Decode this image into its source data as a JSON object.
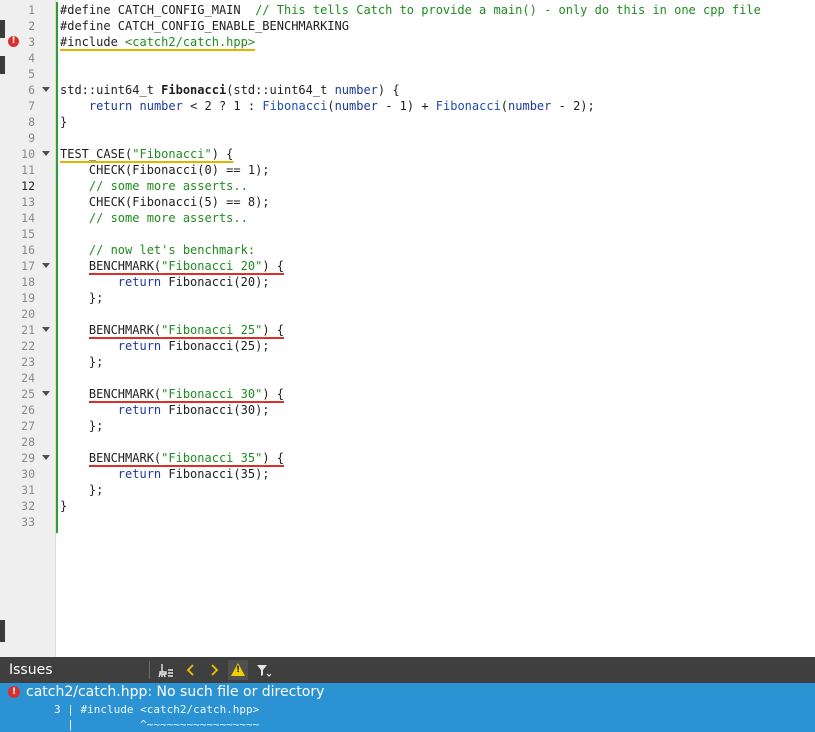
{
  "editor": {
    "current_line": 12,
    "lines": [
      {
        "n": "1",
        "segs": [
          {
            "t": "#define CATCH_CONFIG_MAIN  ",
            "c": "n"
          },
          {
            "t": "// This tells Catch to provide a main() - only do this in one cpp file",
            "c": "c"
          }
        ]
      },
      {
        "n": "2",
        "segs": [
          {
            "t": "#define CATCH_CONFIG_ENABLE_BENCHMARKING",
            "c": "n"
          }
        ]
      },
      {
        "n": "3",
        "error": true,
        "segs": [
          {
            "t": "#include ",
            "c": "n u"
          },
          {
            "t": "<catch2/catch.hpp>",
            "c": "s u"
          }
        ]
      },
      {
        "n": "4",
        "segs": []
      },
      {
        "n": "5",
        "segs": []
      },
      {
        "n": "6",
        "fold": true,
        "segs": [
          {
            "t": "std::uint64_t ",
            "c": "n"
          },
          {
            "t": "Fibonacci",
            "c": "f"
          },
          {
            "t": "(std::uint64_t ",
            "c": "n"
          },
          {
            "t": "number",
            "c": "k"
          },
          {
            "t": ") {",
            "c": "n"
          }
        ]
      },
      {
        "n": "7",
        "segs": [
          {
            "t": "    ",
            "c": "n"
          },
          {
            "t": "return",
            "c": "k"
          },
          {
            "t": " ",
            "c": "n"
          },
          {
            "t": "number",
            "c": "k"
          },
          {
            "t": " < 2 ? 1 : ",
            "c": "n"
          },
          {
            "t": "Fibonacci",
            "c": "fc"
          },
          {
            "t": "(",
            "c": "n"
          },
          {
            "t": "number",
            "c": "k"
          },
          {
            "t": " - 1) + ",
            "c": "n"
          },
          {
            "t": "Fibonacci",
            "c": "fc"
          },
          {
            "t": "(",
            "c": "n"
          },
          {
            "t": "number",
            "c": "k"
          },
          {
            "t": " - 2);",
            "c": "n"
          }
        ]
      },
      {
        "n": "8",
        "segs": [
          {
            "t": "}",
            "c": "n"
          }
        ]
      },
      {
        "n": "9",
        "segs": []
      },
      {
        "n": "10",
        "fold": true,
        "segs": [
          {
            "t": "TEST_CASE(",
            "c": "n u"
          },
          {
            "t": "\"Fibonacci\"",
            "c": "s u"
          },
          {
            "t": ") {",
            "c": "n u"
          }
        ]
      },
      {
        "n": "11",
        "segs": [
          {
            "t": "    CHECK(Fibonacci(0) == 1);",
            "c": "n"
          }
        ]
      },
      {
        "n": "12",
        "segs": [
          {
            "t": "    ",
            "c": "n"
          },
          {
            "t": "// some more asserts..",
            "c": "c"
          }
        ]
      },
      {
        "n": "13",
        "segs": [
          {
            "t": "    CHECK(Fibonacci(5) == 8);",
            "c": "n"
          }
        ]
      },
      {
        "n": "14",
        "segs": [
          {
            "t": "    ",
            "c": "n"
          },
          {
            "t": "// some more asserts..",
            "c": "c"
          }
        ]
      },
      {
        "n": "15",
        "segs": []
      },
      {
        "n": "16",
        "segs": [
          {
            "t": "    ",
            "c": "n"
          },
          {
            "t": "// now let's benchmark:",
            "c": "c"
          }
        ]
      },
      {
        "n": "17",
        "fold": true,
        "segs": [
          {
            "t": "    ",
            "c": "n"
          },
          {
            "t": "BENCHMARK(",
            "c": "n r"
          },
          {
            "t": "\"Fibonacci 20\"",
            "c": "s r"
          },
          {
            "t": ") {",
            "c": "n r"
          }
        ]
      },
      {
        "n": "18",
        "segs": [
          {
            "t": "        ",
            "c": "n"
          },
          {
            "t": "return",
            "c": "k"
          },
          {
            "t": " Fibonacci(20);",
            "c": "n"
          }
        ]
      },
      {
        "n": "19",
        "segs": [
          {
            "t": "    };",
            "c": "n"
          }
        ]
      },
      {
        "n": "20",
        "segs": []
      },
      {
        "n": "21",
        "fold": true,
        "segs": [
          {
            "t": "    ",
            "c": "n"
          },
          {
            "t": "BENCHMARK(",
            "c": "n r"
          },
          {
            "t": "\"Fibonacci 25\"",
            "c": "s r"
          },
          {
            "t": ") {",
            "c": "n r"
          }
        ]
      },
      {
        "n": "22",
        "segs": [
          {
            "t": "        ",
            "c": "n"
          },
          {
            "t": "return",
            "c": "k"
          },
          {
            "t": " Fibonacci(25);",
            "c": "n"
          }
        ]
      },
      {
        "n": "23",
        "segs": [
          {
            "t": "    };",
            "c": "n"
          }
        ]
      },
      {
        "n": "24",
        "segs": []
      },
      {
        "n": "25",
        "fold": true,
        "segs": [
          {
            "t": "    ",
            "c": "n"
          },
          {
            "t": "BENCHMARK(",
            "c": "n r"
          },
          {
            "t": "\"Fibonacci 30\"",
            "c": "s r"
          },
          {
            "t": ") {",
            "c": "n r"
          }
        ]
      },
      {
        "n": "26",
        "segs": [
          {
            "t": "        ",
            "c": "n"
          },
          {
            "t": "return",
            "c": "k"
          },
          {
            "t": " Fibonacci(30);",
            "c": "n"
          }
        ]
      },
      {
        "n": "27",
        "segs": [
          {
            "t": "    };",
            "c": "n"
          }
        ]
      },
      {
        "n": "28",
        "segs": []
      },
      {
        "n": "29",
        "fold": true,
        "segs": [
          {
            "t": "    ",
            "c": "n"
          },
          {
            "t": "BENCHMARK(",
            "c": "n r"
          },
          {
            "t": "\"Fibonacci 35\"",
            "c": "s r"
          },
          {
            "t": ") {",
            "c": "n r"
          }
        ]
      },
      {
        "n": "30",
        "segs": [
          {
            "t": "        ",
            "c": "n"
          },
          {
            "t": "return",
            "c": "k"
          },
          {
            "t": " Fibonacci(35);",
            "c": "n"
          }
        ]
      },
      {
        "n": "31",
        "segs": [
          {
            "t": "    };",
            "c": "n"
          }
        ]
      },
      {
        "n": "32",
        "segs": [
          {
            "t": "}",
            "c": "n"
          }
        ]
      },
      {
        "n": "33",
        "segs": []
      }
    ]
  },
  "issues_panel": {
    "title": "Issues",
    "toolbar": {
      "clean_icon": "broom-icon",
      "prev_icon": "chevron-left-icon",
      "next_icon": "chevron-right-icon",
      "warnings_icon": "warning-icon",
      "filter_icon": "filter-icon"
    },
    "issue": {
      "message": "catch2/catch.hpp: No such file or directory",
      "detail_line": "3 | #include <catch2/catch.hpp>",
      "detail_caret": "  |          ^~~~~~~~~~~~~~~~~~"
    }
  },
  "colors": {
    "comment": "#1f8c1f",
    "keyword": "#1c3a9b",
    "error": "#d9302c",
    "warning_underline": "#e2b400",
    "issues_bg": "#2b93d3",
    "issues_header": "#3f3f3f"
  }
}
